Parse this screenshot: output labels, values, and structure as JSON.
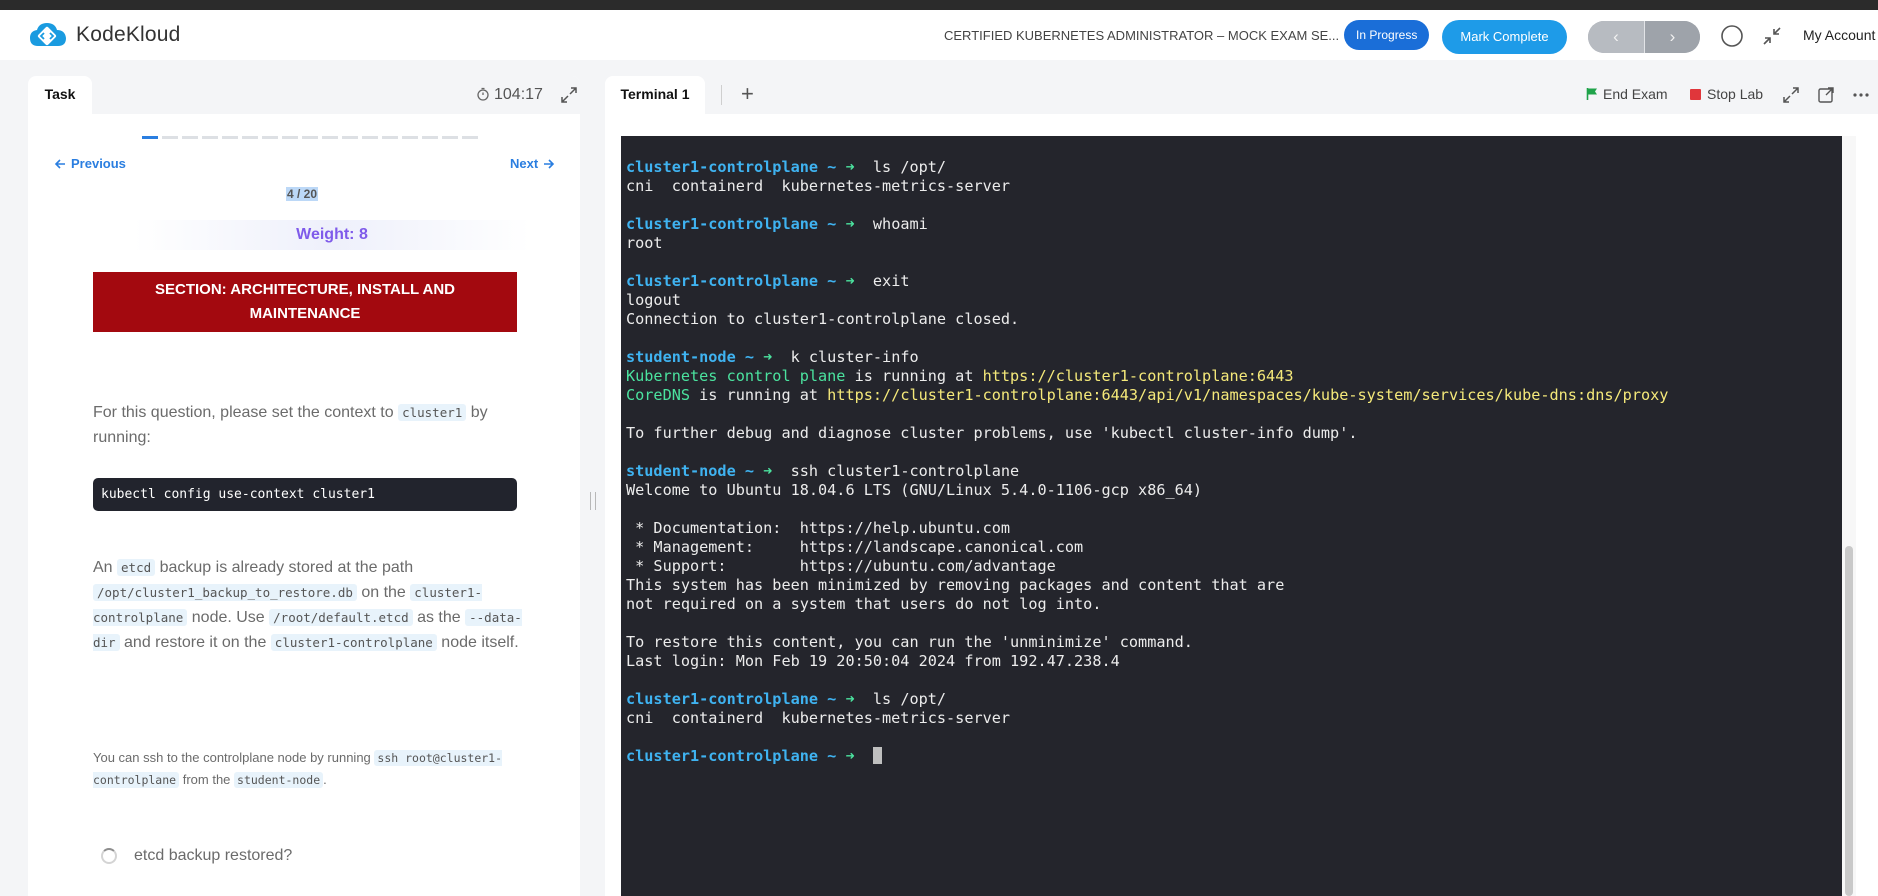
{
  "app": {
    "brand": "KodeKloud",
    "course_title": "CERTIFIED KUBERNETES ADMINISTRATOR – MOCK EXAM SE...",
    "status_badge": "In Progress",
    "mark_complete_label": "Mark Complete",
    "prev_arrow": "‹",
    "next_arrow": "›",
    "account_label": "My Account",
    "colors": {
      "brand_blue": "#1a6ed8",
      "accent_blue": "#1e9be8",
      "section_red": "#a3090f",
      "weight_purple": "#7f5bea",
      "terminal_bg": "#24252c"
    }
  },
  "task": {
    "tab_label": "Task",
    "timer": "104:17",
    "progress": {
      "current": 4,
      "total": 20
    },
    "prev_label": "Previous",
    "next_label": "Next",
    "counter": "4 / 20",
    "weight": "Weight: 8",
    "section_line1": "SECTION: ARCHITECTURE, INSTALL AND",
    "section_line2": "MAINTENANCE",
    "p1_a": "For this question, please set the context to",
    "p1_code": "cluster1",
    "p1_b": "by running:",
    "code_block": "kubectl config use-context cluster1",
    "p2_a": "An",
    "p2_code1": "etcd",
    "p2_b": "backup is already stored at the path",
    "p2_code2": "/opt/cluster1_backup_to_restore.db",
    "p2_c": "on the",
    "p2_code3": "cluster1-controlplane",
    "p2_d": "node. Use",
    "p2_code4": "/root/default.etcd",
    "p2_e": "as the",
    "p2_code5": "--data-dir",
    "p2_f": "and restore it on the",
    "p2_code6": "cluster1-controlplane",
    "p2_g": "node itself.",
    "p3_a": "You can ssh to the controlplane node by running",
    "p3_code1": "ssh root@cluster1-controlplane",
    "p3_b": "from the",
    "p3_code2": "student-node",
    "p3_c": ".",
    "check_label": "etcd backup restored?"
  },
  "terminal": {
    "tab_label": "Terminal 1",
    "add_tab": "+",
    "end_exam_label": "End Exam",
    "stop_lab_label": "Stop Lab",
    "lines": [
      {
        "host": "cluster1-controlplane",
        "cmd": "ls /opt/"
      },
      {
        "text": "cni  containerd  kubernetes-metrics-server"
      },
      {
        "text": ""
      },
      {
        "host": "cluster1-controlplane",
        "cmd": "whoami"
      },
      {
        "text": "root"
      },
      {
        "text": ""
      },
      {
        "host": "cluster1-controlplane",
        "cmd": "exit"
      },
      {
        "text": "logout"
      },
      {
        "text": "Connection to cluster1-controlplane closed."
      },
      {
        "text": ""
      },
      {
        "host": "student-node",
        "cmd": "k cluster-info"
      },
      {
        "green": "Kubernetes control plane",
        "mid": " is running at ",
        "yellow": "https://cluster1-controlplane:6443"
      },
      {
        "green": "CoreDNS",
        "mid": " is running at ",
        "yellow": "https://cluster1-controlplane:6443/api/v1/namespaces/kube-system/services/kube-dns:dns/proxy"
      },
      {
        "text": ""
      },
      {
        "text": "To further debug and diagnose cluster problems, use 'kubectl cluster-info dump'."
      },
      {
        "text": ""
      },
      {
        "host": "student-node",
        "cmd": "ssh cluster1-controlplane"
      },
      {
        "text": "Welcome to Ubuntu 18.04.6 LTS (GNU/Linux 5.4.0-1106-gcp x86_64)"
      },
      {
        "text": ""
      },
      {
        "text": " * Documentation:  https://help.ubuntu.com"
      },
      {
        "text": " * Management:     https://landscape.canonical.com"
      },
      {
        "text": " * Support:        https://ubuntu.com/advantage"
      },
      {
        "text": "This system has been minimized by removing packages and content that are"
      },
      {
        "text": "not required on a system that users do not log into."
      },
      {
        "text": ""
      },
      {
        "text": "To restore this content, you can run the 'unminimize' command."
      },
      {
        "text": "Last login: Mon Feb 19 20:50:04 2024 from 192.47.238.4"
      },
      {
        "text": ""
      },
      {
        "host": "cluster1-controlplane",
        "cmd": "ls /opt/"
      },
      {
        "text": "cni  containerd  kubernetes-metrics-server"
      },
      {
        "text": ""
      },
      {
        "host": "cluster1-controlplane",
        "cmd": "",
        "cursor": true
      }
    ],
    "prompt_suffix": " ~ ➜  "
  }
}
